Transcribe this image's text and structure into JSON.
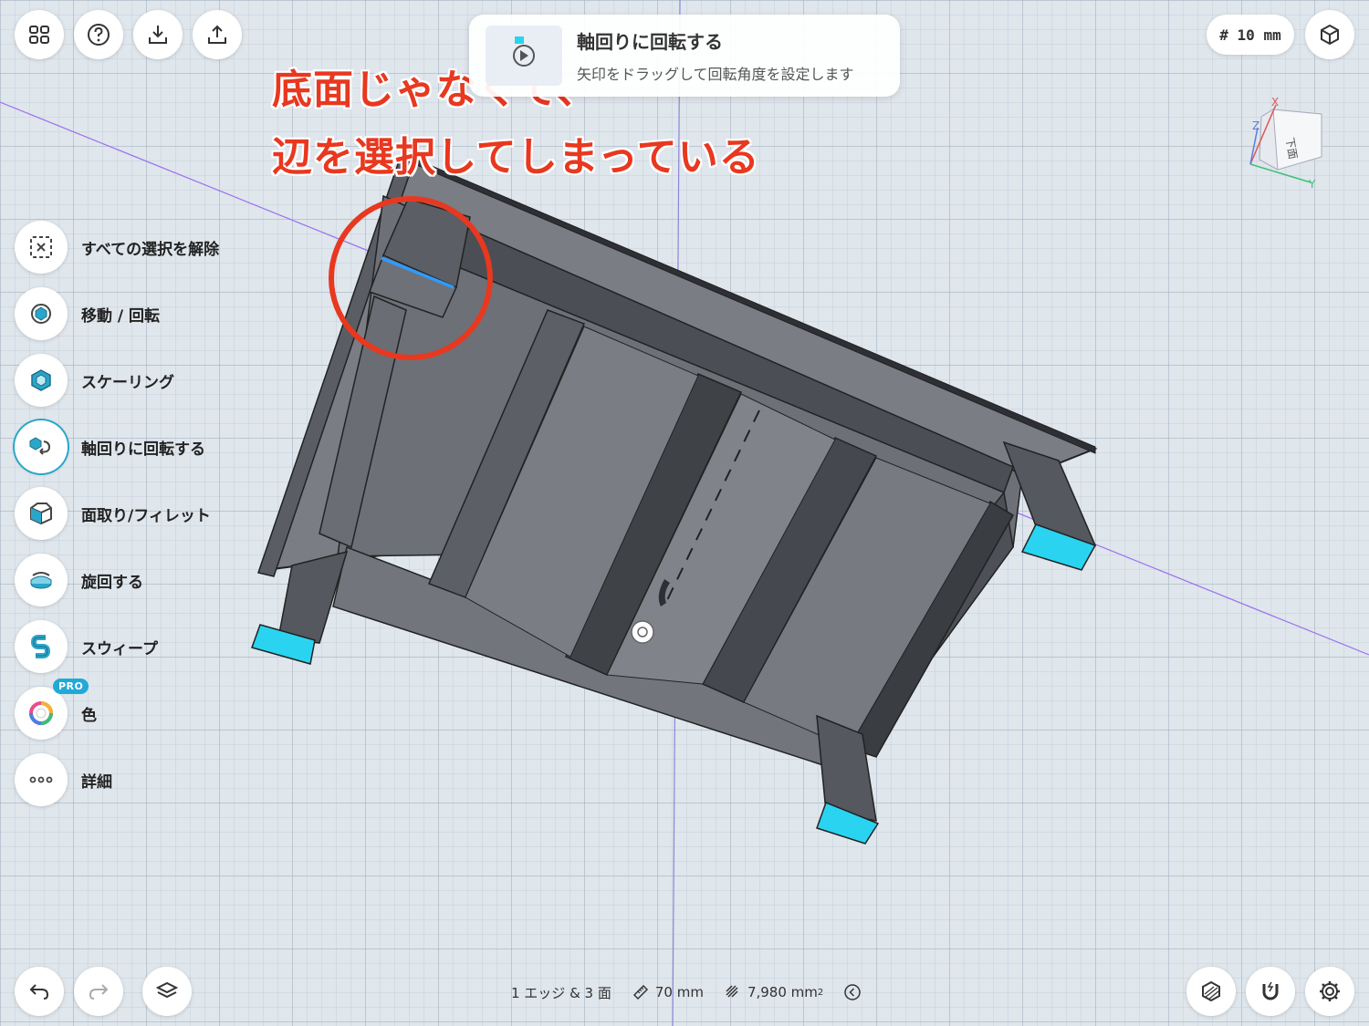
{
  "top_toolbar": {
    "left_buttons": [
      {
        "name": "grid-menu"
      },
      {
        "name": "help"
      },
      {
        "name": "import"
      },
      {
        "name": "export"
      }
    ],
    "unit": "# 10 mm"
  },
  "hint": {
    "title": "軸回りに回転する",
    "description": "矢印をドラッグして回転角度を設定します"
  },
  "annotation": {
    "line1": "底面じゃなくて、",
    "line2": "辺を選択してしまっている",
    "color": "#e8381f"
  },
  "view_cube": {
    "face_label": "下面",
    "axis_x": "X",
    "axis_y": "Y",
    "axis_z": "Z"
  },
  "tools": [
    {
      "label": "すべての選択を解除",
      "icon": "deselect-icon"
    },
    {
      "label": "移動 / 回転",
      "icon": "move-rotate-icon"
    },
    {
      "label": "スケーリング",
      "icon": "scale-icon"
    },
    {
      "label": "軸回りに回転する",
      "icon": "axis-rotate-icon",
      "active": true
    },
    {
      "label": "面取り/フィレット",
      "icon": "chamfer-icon"
    },
    {
      "label": "旋回する",
      "icon": "revolve-icon"
    },
    {
      "label": "スウィープ",
      "icon": "sweep-icon"
    },
    {
      "label": "色",
      "icon": "color-icon",
      "badge": "PRO"
    },
    {
      "label": "詳細",
      "icon": "more-icon"
    }
  ],
  "status": {
    "selection": "1 エッジ & 3 面",
    "length": "70 mm",
    "area": "7,980 mm",
    "area_sup": "2"
  },
  "colors": {
    "accent": "#2aa6c9",
    "model_face": "#6b6e75",
    "selected_face": "#2ad4f0",
    "selected_edge": "#2f9bff"
  }
}
